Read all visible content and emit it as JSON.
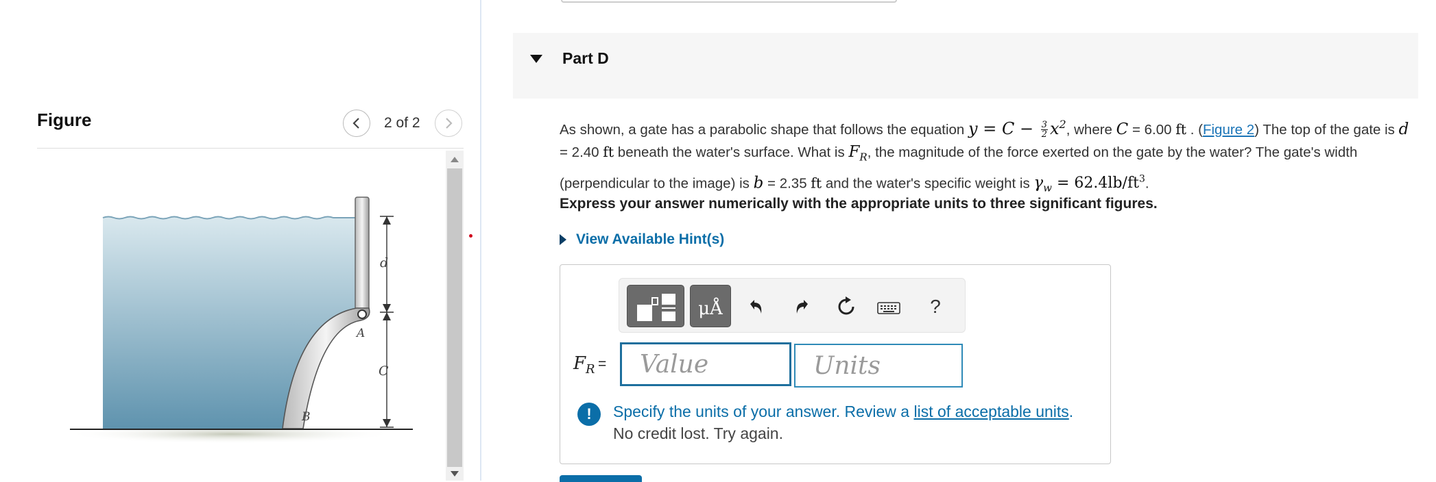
{
  "figure_panel": {
    "title": "Figure",
    "page_count": "2 of 2",
    "diagram_labels": {
      "d": "d",
      "c": "C",
      "a": "A",
      "b": "B"
    }
  },
  "part": {
    "title": "Part D"
  },
  "problem": {
    "p1": "As shown, a gate has a parabolic shape that follows the equation ",
    "eq_main": "y = C − ",
    "eq_frac_num": "3",
    "eq_frac_den": "2",
    "eq_x": "x",
    "eq_exp": "2",
    "p2": ", where ",
    "c_var": "C",
    "c_value": " = 6.00 ",
    "ft": "ft",
    "p3": " . (",
    "figure_link": "Figure 2",
    "p4": ") The top of the gate is ",
    "d_var": "d",
    "d_value": " = 2.40 ",
    "p5": " beneath the water's surface. What is ",
    "fr_var": "F",
    "fr_sub": "R",
    "p6": ", the magnitude of the force exerted on the gate by the water? The gate's width (perpendicular to the image) is ",
    "b_var": "b",
    "b_value": " = 2.35 ",
    "p7": " and the water's specific weight is ",
    "gamma": "γ",
    "gamma_sub": "w",
    "gamma_value": " = 62.4lb/ft",
    "gamma_exp": "3",
    "end": "."
  },
  "instruction": "Express your answer numerically with the appropriate units to three significant figures.",
  "hint_label": "View Available Hint(s)",
  "toolbar": {
    "units_symbol": "μÅ",
    "help": "?"
  },
  "answer": {
    "label_var": "F",
    "label_sub": "R",
    "label_eq": "=",
    "value_placeholder": "Value",
    "units_placeholder": "Units"
  },
  "feedback": {
    "icon": "!",
    "line1_prefix": "Specify the units of your answer. Review a ",
    "line1_link": "list of acceptable units",
    "line1_suffix": ".",
    "line2": "No credit lost. Try again."
  }
}
